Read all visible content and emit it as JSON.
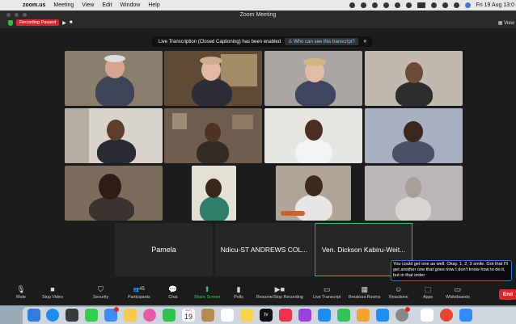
{
  "menubar": {
    "apple_glyph": "",
    "app_name": "zoom.us",
    "items": [
      "Meeting",
      "View",
      "Edit",
      "Window",
      "Help"
    ],
    "clock": "Fri 19 Aug 13:0"
  },
  "window": {
    "title": "Zoom Meeting"
  },
  "recording": {
    "label": "Recording Paused",
    "play": "▶",
    "stop": "■"
  },
  "view_button": "View",
  "banner": {
    "message": "Live Transcription (Closed Captioning) has been enabled",
    "who_label": "Who can see this transcript?",
    "close": "✕"
  },
  "video_grid": {
    "colors": {
      "tile_bg_1": "#8d8475",
      "tile_bg_2": "#6e5a44",
      "tile_bg_3": "#9a9890",
      "tile_bg_4": "#b7a99a",
      "active_border": "#31c256"
    }
  },
  "name_tiles": [
    "Pamela",
    "Ndicu-ST ANDREWS COL...",
    "Ven. Dickson Kabiru-Weit..."
  ],
  "caption": {
    "text": "You could get one as well. Okay. 1, 2, 3 smile. Got that I'll get another one that goes now I don't know how to do it, but in that order"
  },
  "toolbar": {
    "mute": "Mute",
    "stop_video": "Stop Video",
    "security": "Security",
    "participants": "Participants",
    "participants_count": "45",
    "chat": "Chat",
    "share_screen": "Share Screen",
    "polls": "Polls",
    "resume_recording": "Resume/Stop Recording",
    "live_transcript": "Live Transcript",
    "breakout_rooms": "Breakout Rooms",
    "reactions": "Reactions",
    "apps": "Apps",
    "whiteboards": "Whiteboards",
    "end": "End"
  },
  "dock": {
    "calendar_month": "AUG",
    "calendar_day": "19",
    "tv_label": "tv"
  }
}
